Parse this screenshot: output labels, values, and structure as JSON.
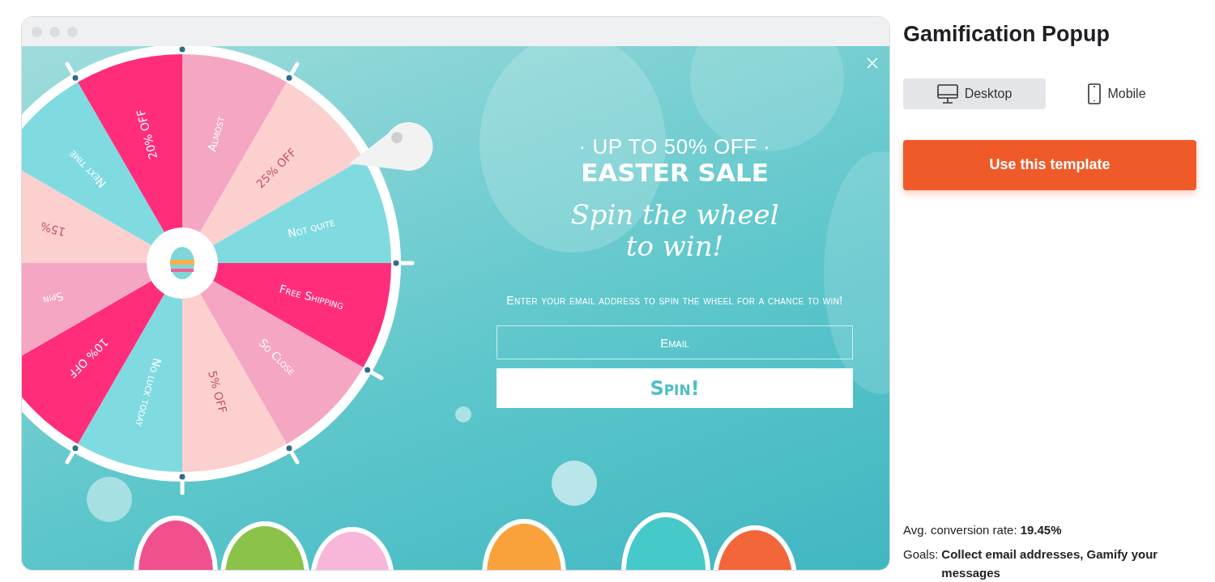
{
  "wheel": {
    "segments": [
      {
        "label": "Free Shipping",
        "color": "#ff2d7a"
      },
      {
        "label": "So Close",
        "color": "#f4a6c2"
      },
      {
        "label": "5% OFF",
        "color": "#fbd0cf"
      },
      {
        "label": "No luck today",
        "color": "#80dbe0"
      },
      {
        "label": "10% OFF",
        "color": "#ff2d7a"
      },
      {
        "label": "Spin",
        "color": "#f4a6c2"
      },
      {
        "label": "15%",
        "color": "#fbd0cf"
      },
      {
        "label": "Next time",
        "color": "#80dbe0"
      },
      {
        "label": "20% OFF",
        "color": "#ff2d7a"
      },
      {
        "label": "Almost",
        "color": "#f4a6c2"
      },
      {
        "label": "25% OFF",
        "color": "#fbd0cf"
      },
      {
        "label": "Not quite",
        "color": "#80dbe0"
      }
    ]
  },
  "popup": {
    "kicker": "· UP TO 50% OFF ·",
    "headline": "EASTER SALE",
    "script_title": "Spin the wheel to win!",
    "description": "Enter your email address to spin the wheel for a chance to win!",
    "email": {
      "placeholder": "Email"
    },
    "button": "Spin!"
  },
  "sidebar": {
    "title": "Gamification Popup",
    "devices": [
      {
        "label": "Desktop",
        "kind": "desktop",
        "selected": true
      },
      {
        "label": "Mobile",
        "kind": "mobile",
        "selected": false
      }
    ],
    "cta": "Use this template",
    "stats": [
      {
        "label": "Avg. conversion rate:",
        "value": "19.45%"
      },
      {
        "label": "Goals:",
        "value": "Collect email addresses, Gamify your messages"
      }
    ]
  }
}
